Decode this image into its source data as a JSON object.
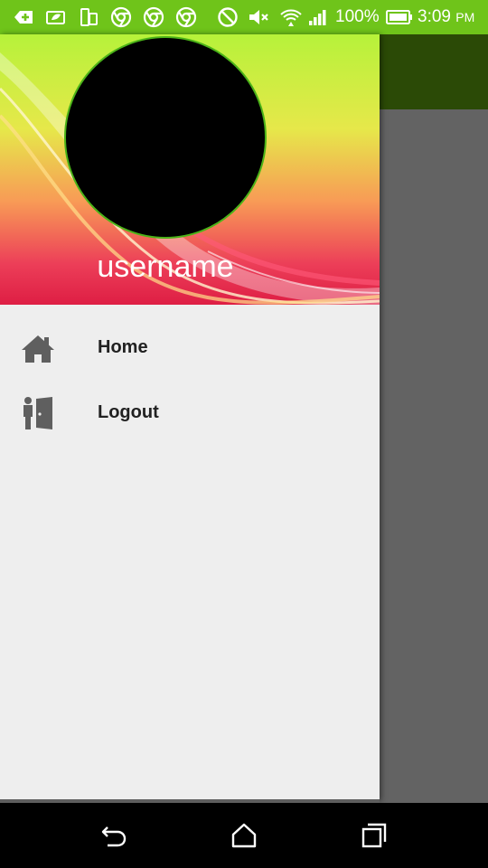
{
  "status_bar": {
    "battery_percent": "100%",
    "time": "3:09",
    "ampm": "PM",
    "background_color": "#6fc41a",
    "icons": [
      "add-box-icon",
      "leaf-battery-icon",
      "device-icon",
      "chrome-icon",
      "chrome-icon",
      "chrome-icon",
      "do-not-disturb-icon",
      "muted-volume-icon",
      "wifi-icon",
      "signal-icon",
      "battery-icon"
    ]
  },
  "drawer": {
    "username": "username",
    "menu": [
      {
        "label": "Home",
        "icon": "home-icon"
      },
      {
        "label": "Logout",
        "icon": "logout-door-icon"
      }
    ]
  },
  "colors": {
    "toolbar": "#2b4a06",
    "drawer_bg": "#eeeeee",
    "avatar_border": "#4bb318"
  },
  "nav_bar": {
    "buttons": [
      "back-icon",
      "home-outline-icon",
      "recents-icon"
    ]
  }
}
